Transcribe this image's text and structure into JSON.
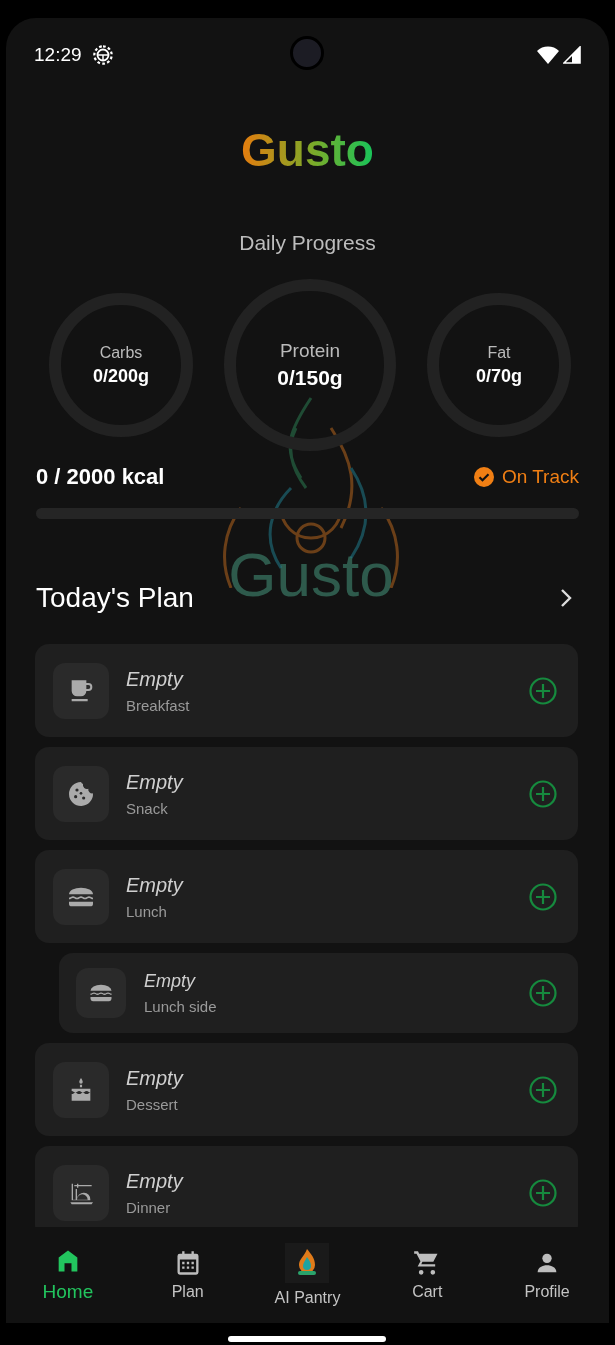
{
  "status_bar": {
    "time": "12:29"
  },
  "app_title": "Gusto",
  "background_logo": "Gusto",
  "daily_progress": {
    "title": "Daily Progress",
    "macros": [
      {
        "label": "Carbs",
        "value": "0/200g"
      },
      {
        "label": "Protein",
        "value": "0/150g"
      },
      {
        "label": "Fat",
        "value": "0/70g"
      }
    ],
    "calories": "0 / 2000 kcal",
    "status": "On Track",
    "level": 0
  },
  "todays_plan": {
    "title": "Today's Plan",
    "meals": [
      {
        "name": "Empty",
        "slot": "Breakfast",
        "kind": "main"
      },
      {
        "name": "Empty",
        "slot": "Snack",
        "kind": "main"
      },
      {
        "name": "Empty",
        "slot": "Lunch",
        "kind": "main"
      },
      {
        "name": "Empty",
        "slot": "Lunch side",
        "kind": "side"
      },
      {
        "name": "Empty",
        "slot": "Dessert",
        "kind": "main"
      },
      {
        "name": "Empty",
        "slot": "Dinner",
        "kind": "main"
      }
    ]
  },
  "bottom_nav": [
    {
      "label": "Home",
      "selected": true
    },
    {
      "label": "Plan",
      "selected": false
    },
    {
      "label": "AI Pantry",
      "selected": false
    },
    {
      "label": "Cart",
      "selected": false
    },
    {
      "label": "Profile",
      "selected": false
    }
  ]
}
